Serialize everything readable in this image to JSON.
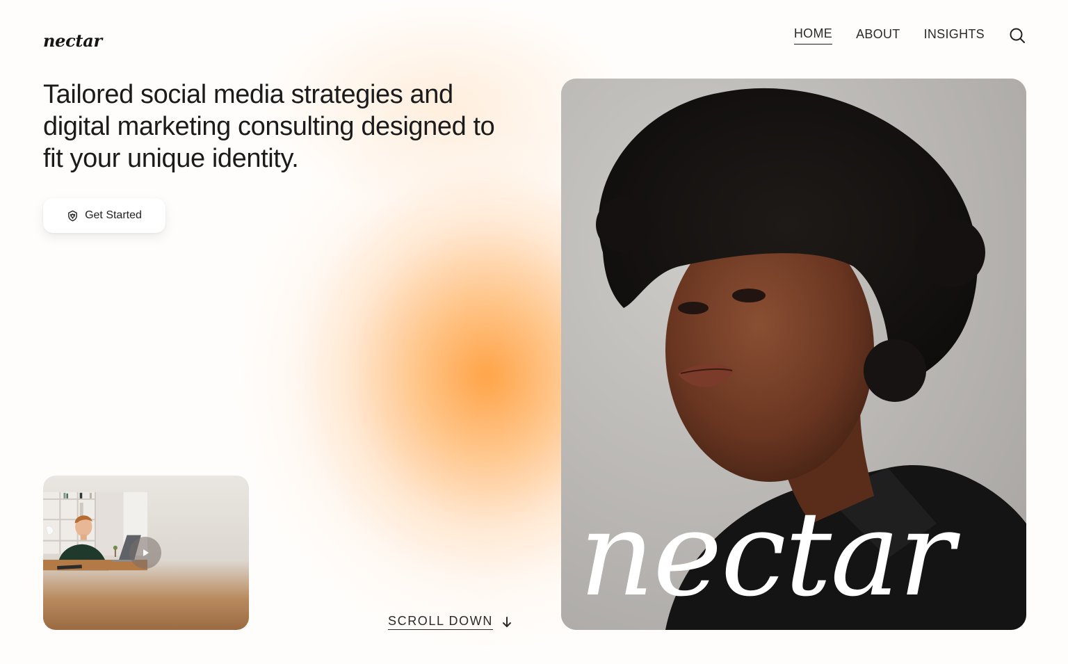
{
  "brand": {
    "logo_text": "nectar",
    "wordmark": "nectar",
    "accent_color": "#ffa64d"
  },
  "nav": {
    "items": [
      {
        "label": "HOME",
        "active": true
      },
      {
        "label": "ABOUT",
        "active": false
      },
      {
        "label": "INSIGHTS",
        "active": false
      }
    ],
    "search_icon": "search-icon"
  },
  "hero": {
    "headline": "Tailored social media strategies and digital marketing consulting designed to fit your unique identity.",
    "cta_label": "Get Started",
    "cta_icon": "tulip-shield-icon"
  },
  "video": {
    "play_icon": "play-icon"
  },
  "scroll": {
    "label": "SCROLL DOWN",
    "icon": "arrow-down-icon"
  }
}
